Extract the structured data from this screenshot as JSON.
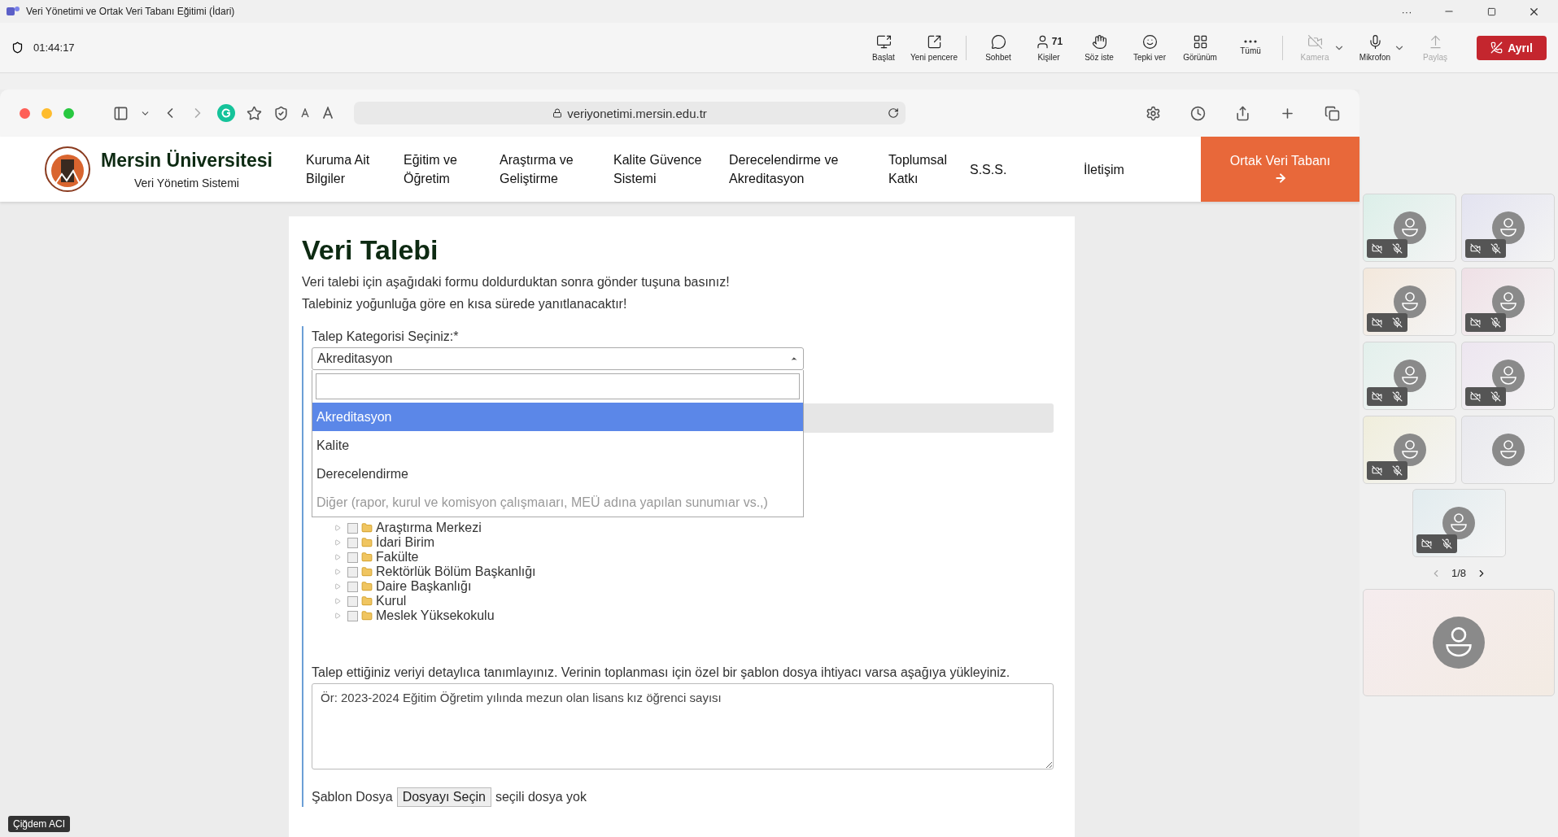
{
  "window": {
    "title": "Veri Yönetimi ve Ortak Veri Tabanı Eğitimi (İdari)",
    "controls": [
      "···"
    ]
  },
  "meeting": {
    "timer": "01:44:17",
    "tools": [
      {
        "kind": "present",
        "label": "Başlat",
        "disabled": false
      },
      {
        "kind": "popout",
        "label": "Yeni pencere",
        "disabled": false
      },
      {
        "kind": "chat",
        "label": "Sohbet",
        "disabled": false
      },
      {
        "kind": "people",
        "label": "Kişiler",
        "count": "71",
        "disabled": false
      },
      {
        "kind": "hand",
        "label": "Söz iste",
        "disabled": false
      },
      {
        "kind": "react",
        "label": "Tepki ver",
        "disabled": false
      },
      {
        "kind": "view",
        "label": "Görünüm",
        "disabled": false
      },
      {
        "kind": "more",
        "label": "Tümü",
        "disabled": false
      },
      {
        "kind": "camera",
        "label": "Kamera",
        "disabled": true
      },
      {
        "kind": "mic",
        "label": "Mikrofon",
        "disabled": false
      },
      {
        "kind": "share",
        "label": "Paylaş",
        "disabled": true
      }
    ],
    "leave_button": "Ayrıl"
  },
  "browser": {
    "url": "veriyonetimi.mersin.edu.tr"
  },
  "site": {
    "name": "Mersin Üniversitesi",
    "subtitle": "Veri Yönetim Sistemi",
    "menu": [
      "Kuruma Ait Bilgiler",
      "Eğitim ve Öğretim",
      "Araştırma ve Geliştirme",
      "Kalite Güvence Sistemi",
      "Derecelendirme ve Akreditasyon",
      "Toplumsal Katkı",
      "S.S.S.",
      "İletişim"
    ],
    "cta": "Ortak Veri Tabanı"
  },
  "form": {
    "title": "Veri Talebi",
    "intro": [
      "Veri talebi için aşağıdaki formu doldurduktan sonra gönder tuşuna basınız!",
      "Talebiniz yoğunluğa göre en kısa sürede yanıtlanacaktır!"
    ],
    "category_label": "Talep Kategorisi Seçiniz:*",
    "category_value": "Akreditasyon",
    "options": [
      {
        "label": "Akreditasyon",
        "selected": true,
        "disabled": false
      },
      {
        "label": "Kalite",
        "selected": false,
        "disabled": false
      },
      {
        "label": "Derecelendirme",
        "selected": false,
        "disabled": false
      },
      {
        "label": "Diğer (rapor, kurul ve komisyon çalışmaıarı, MEÜ adına yapılan sunumıar vs.,)",
        "selected": false,
        "disabled": true
      }
    ],
    "units": [
      {
        "label": "Araştırma Merkezi",
        "checked": false
      },
      {
        "label": "İdari Birim",
        "checked": false
      },
      {
        "label": "Fakülte",
        "checked": false
      },
      {
        "label": "Rektörlük Bölüm Başkanlığı",
        "checked": false
      },
      {
        "label": "Daire Başkanlığı",
        "checked": false
      },
      {
        "label": "Kurul",
        "checked": false
      },
      {
        "label": "Meslek Yüksekokulu",
        "checked": false
      }
    ],
    "description_label": "Talep ettiğiniz veriyi detaylıca tanımlayınız. Verinin toplanması için özel bir şablon dosya ihtiyacı varsa aşağıya yükleyiniz.",
    "description_placeholder": "Ör: 2023-2024 Eğitim Öğretim yılında mezun olan lisans kız öğrenci sayısı",
    "file_label": "Şablon Dosya",
    "file_button": "Dosyayı Seçin",
    "file_status": "seçili dosya yok"
  },
  "participants": [
    {
      "muted": true,
      "color": "#dcefe9"
    },
    {
      "muted": true,
      "color": "#e3e3f0"
    },
    {
      "muted": true,
      "color": "#f3e8dc"
    },
    {
      "muted": true,
      "color": "#efe0e6"
    },
    {
      "muted": true,
      "color": "#e3f0ec"
    },
    {
      "muted": true,
      "color": "#ede6f0"
    },
    {
      "muted": true,
      "color": "#f0eedc"
    },
    {
      "muted": false,
      "color": "#e9e9ee"
    },
    {
      "muted": true,
      "color": "#e2ecef"
    }
  ],
  "pager": "1/8",
  "presenter_label": "Çiğdem ACI"
}
